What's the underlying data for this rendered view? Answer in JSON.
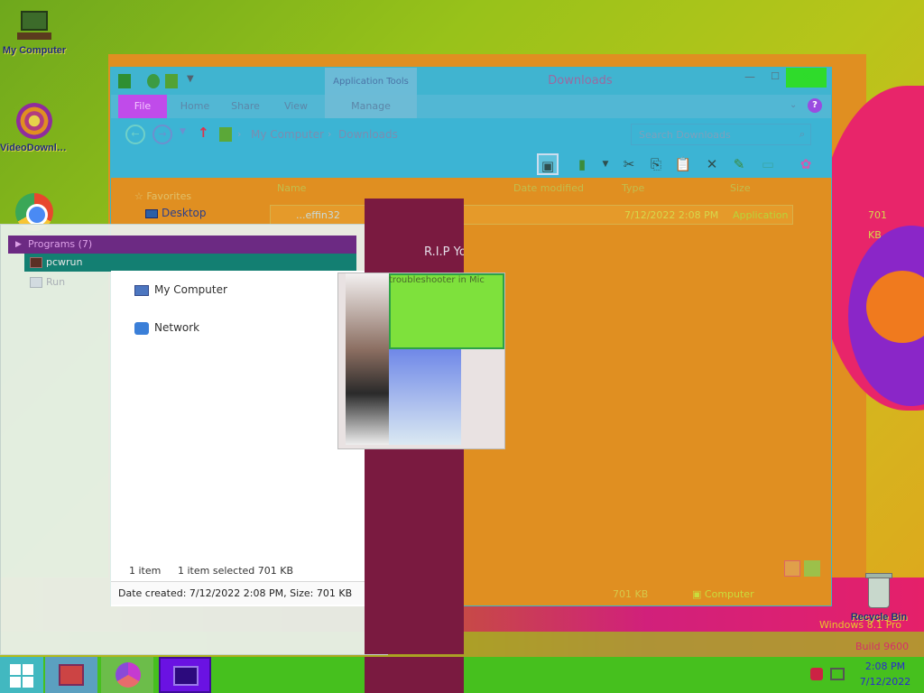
{
  "desktop": {
    "icons": [
      {
        "label": "My Computer"
      },
      {
        "label": "VideoDownloader"
      },
      {
        "label": "Recycle Bin"
      }
    ],
    "watermark": "Windows 8.1 Pro",
    "watermark_build": "Build 9600"
  },
  "explorer": {
    "title": "Downloads",
    "application_tools": "Application Tools",
    "ribbon_tabs": [
      "File",
      "Home",
      "Share",
      "View",
      "Manage"
    ],
    "breadcrumb": [
      "My Computer",
      "Downloads"
    ],
    "search_placeholder": "Search Downloads",
    "columns": [
      "Name",
      "Date modified",
      "Type",
      "Size"
    ],
    "nav": {
      "favorites": "Favorites",
      "desktop": "Desktop",
      "my_computer": "My Computer",
      "network": "Network"
    },
    "files": [
      {
        "name": "...effin32",
        "date": "7/12/2022 2:08 PM",
        "type": "Application",
        "size": "701 KB"
      }
    ],
    "status": {
      "count": "1 item",
      "selected": "1 item selected  701 KB",
      "size": "701 KB",
      "location": "Computer"
    },
    "details_pane": "Date created: 7/12/2022 2:08 PM, Size: 701 KB"
  },
  "start_menu": {
    "group_label": "Programs (7)",
    "items": [
      "pcwrun",
      "Run"
    ]
  },
  "video": {
    "title": "R.I.P Yo",
    "caption": "troubleshooter in Mic"
  },
  "taskbar": {
    "time": "2:08 PM",
    "date": "7/12/2022"
  },
  "colors": {
    "accent": "#3cb4d4",
    "file_tab": "#c04bea",
    "taskbar": "#46c01e"
  }
}
